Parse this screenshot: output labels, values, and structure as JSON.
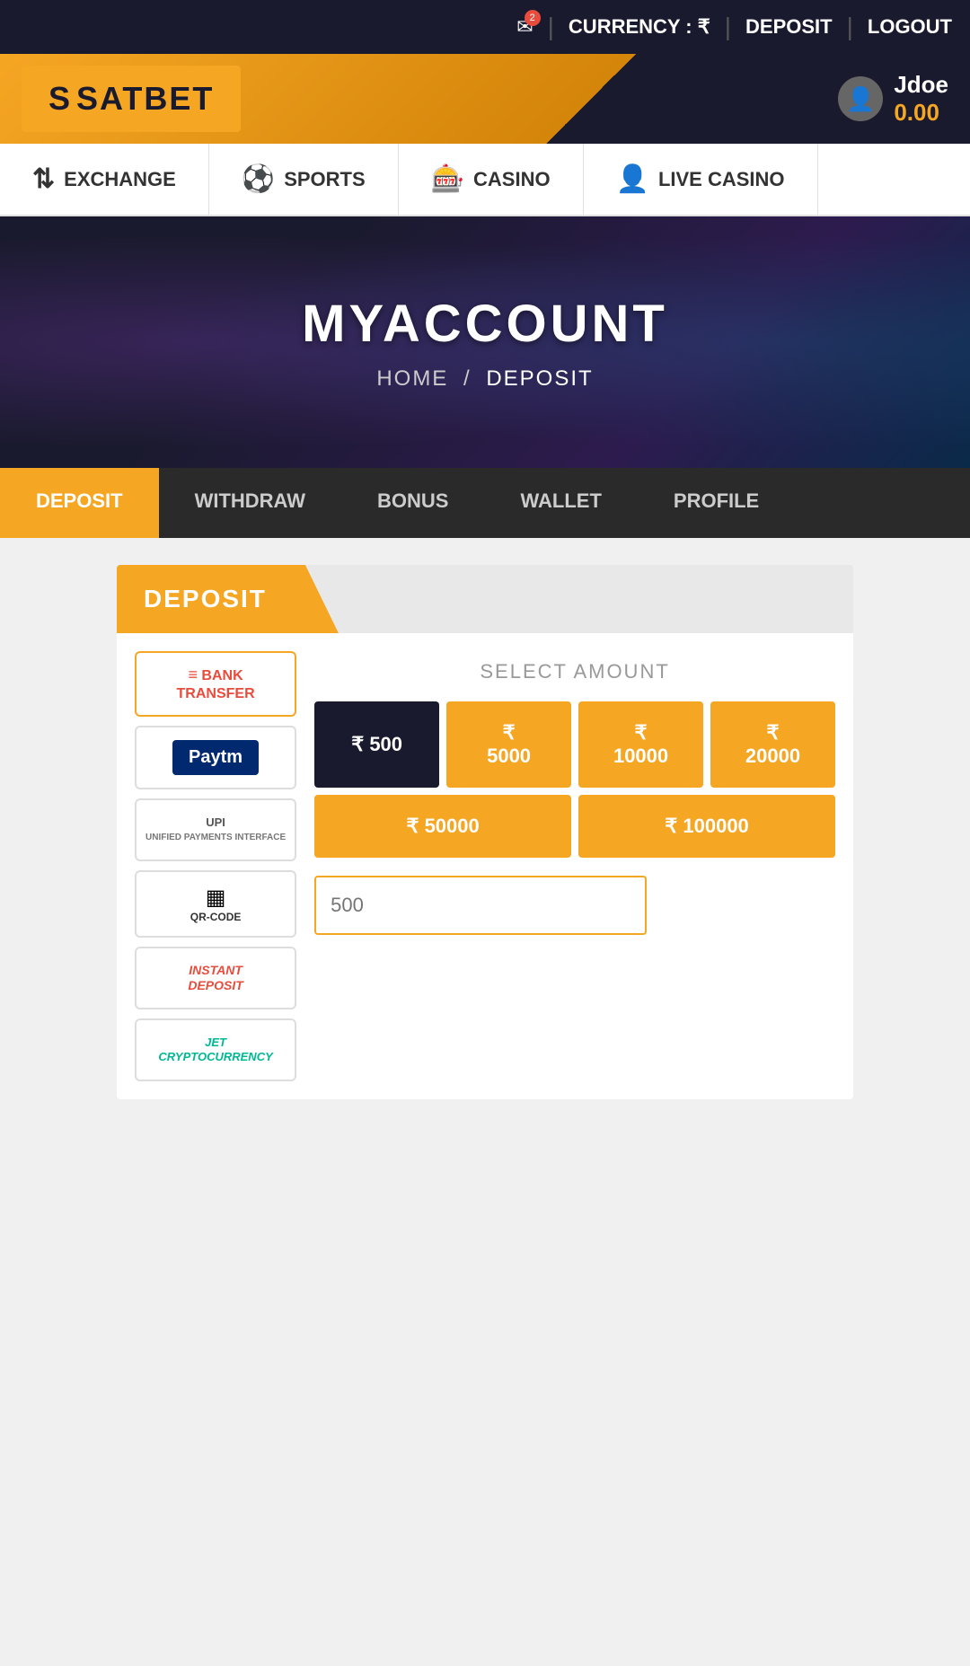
{
  "topbar": {
    "mail_icon": "✉",
    "badge": "2",
    "separator": "|",
    "currency_label": "CURRENCY : ₹",
    "deposit_label": "DEPOSIT",
    "logout_label": "LOGOUT"
  },
  "header": {
    "logo": "SATBET",
    "username": "Jdoe",
    "balance": "0.00"
  },
  "nav": {
    "items": [
      {
        "label": "EXCHANGE",
        "icon": "⇅"
      },
      {
        "label": "SPORTS",
        "icon": "⚽"
      },
      {
        "label": "CASINO",
        "icon": "🎰"
      },
      {
        "label": "LIVE CASINO",
        "icon": "👤"
      }
    ]
  },
  "hero": {
    "title": "MYACCOUNT",
    "breadcrumb_home": "HOME",
    "breadcrumb_sep": "/",
    "breadcrumb_current": "DEPOSIT"
  },
  "account_tabs": [
    {
      "label": "DEPOSIT",
      "active": true
    },
    {
      "label": "WITHDRAW",
      "active": false
    },
    {
      "label": "BONUS",
      "active": false
    },
    {
      "label": "WALLET",
      "active": false
    },
    {
      "label": "PROFILE",
      "active": false
    }
  ],
  "deposit_section": {
    "header": "DEPOSIT",
    "select_amount_label": "SELECT AMOUNT",
    "amount_buttons": [
      {
        "label": "₹  500",
        "selected": true
      },
      {
        "label": "₹ 5000",
        "selected": false
      },
      {
        "label": "₹ 10000",
        "selected": false
      },
      {
        "label": "₹ 20000",
        "selected": false
      }
    ],
    "amount_buttons_row2": [
      {
        "label": "₹  50000",
        "selected": false
      },
      {
        "label": "₹  100000",
        "selected": false
      }
    ],
    "amount_input_placeholder": "500"
  },
  "payment_methods": [
    {
      "label": "BANK\nTRANSFER",
      "type": "bank"
    },
    {
      "label": "Paytm",
      "type": "paytm"
    },
    {
      "label": "UPI",
      "type": "upi"
    },
    {
      "label": "QR-CODE",
      "type": "qr"
    },
    {
      "label": "INSTANT\nDEPOSIT",
      "type": "instant"
    },
    {
      "label": "JET\nCRYPTOCURRENCY",
      "type": "jet"
    }
  ]
}
